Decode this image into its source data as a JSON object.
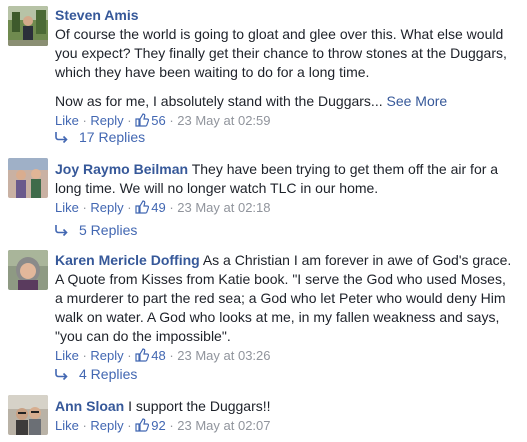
{
  "labels": {
    "like": "Like",
    "reply": "Reply",
    "see_more": "See More",
    "sep": " · "
  },
  "comments": [
    {
      "author": "Steven Amis",
      "paragraphs": [
        "Of course the world is going to gloat and glee over this. What else would you expect? They finally get their chance to throw stones at the Duggars, which they have been waiting to do for a long time.",
        "Now as for me, I absolutely stand with the Duggars..."
      ],
      "likes": "56",
      "timestamp": "23 May at 02:59",
      "replies": "17 Replies"
    },
    {
      "author": "Joy Raymo Beilman",
      "text": "They have been trying to get them off the air for a long time. We will no longer watch TLC in our home.",
      "likes": "49",
      "timestamp": "23 May at 02:18",
      "replies": "5 Replies"
    },
    {
      "author": "Karen Mericle Doffing",
      "text": "As a Christian I am forever in awe of God's grace. A Quote from Kisses from Katie book. \"I serve the God who used Moses, a murderer to part the red sea; a God who let Peter who would deny Him walk on water. A God who looks at me, in my fallen weakness and says, \"you can do the impossible\".",
      "likes": "48",
      "timestamp": "23 May at 03:26",
      "replies": "4 Replies"
    },
    {
      "author": "Ann Sloan",
      "text": "I support the Duggars!!",
      "likes": "92",
      "timestamp": "23 May at 02:07"
    }
  ]
}
